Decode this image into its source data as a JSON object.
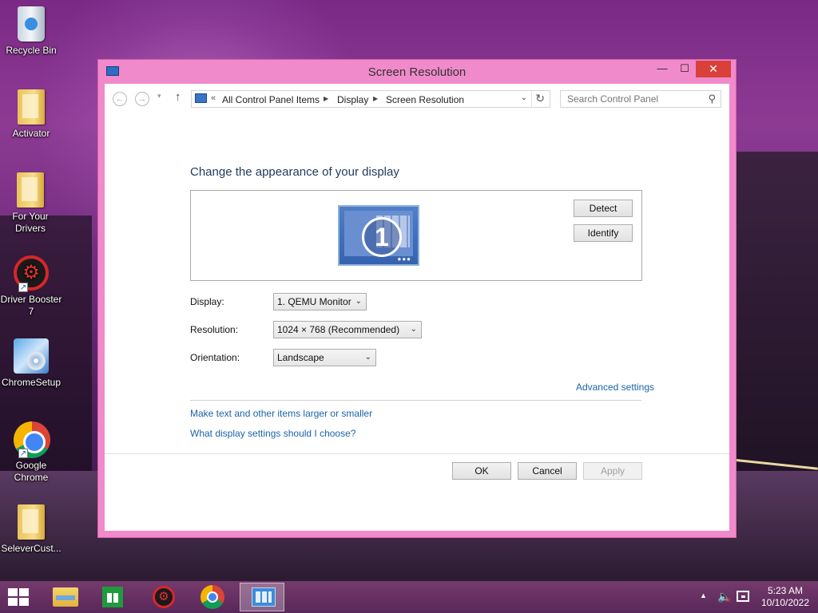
{
  "desktop": {
    "icons": [
      {
        "label": "Recycle Bin",
        "icon": "recycle-bin-icon"
      },
      {
        "label": "Activator",
        "icon": "folder-icon"
      },
      {
        "label": "For Your Drivers",
        "icon": "folder-icon"
      },
      {
        "label": "Driver Booster 7",
        "icon": "driver-booster-icon"
      },
      {
        "label": "ChromeSetup",
        "icon": "setup-cd-icon"
      },
      {
        "label": "Google Chrome",
        "icon": "chrome-icon"
      },
      {
        "label": "SeleverCust...",
        "icon": "folder-icon"
      }
    ]
  },
  "window": {
    "title": "Screen Resolution",
    "minimize_glyph": "—",
    "maximize_glyph": "☐",
    "close_glyph": "✕",
    "address": {
      "prefix": "«",
      "crumbs": [
        "All Control Panel Items",
        "Display",
        "Screen Resolution"
      ]
    },
    "search": {
      "placeholder": "Search Control Panel"
    },
    "heading": "Change the appearance of your display",
    "monitor_number": "1",
    "detect_label": "Detect",
    "identify_label": "Identify",
    "display_label": "Display:",
    "display_value": "1. QEMU Monitor",
    "resolution_label": "Resolution:",
    "resolution_value": "1024 × 768 (Recommended)",
    "orientation_label": "Orientation:",
    "orientation_value": "Landscape",
    "advanced_link": "Advanced settings",
    "text_size_link": "Make text and other items larger or smaller",
    "which_settings_link": "What display settings should I choose?",
    "ok_label": "OK",
    "cancel_label": "Cancel",
    "apply_label": "Apply"
  },
  "taskbar": {
    "items": [
      "file-explorer-icon",
      "store-icon",
      "driver-booster-icon",
      "chrome-icon",
      "screen-resolution-icon"
    ],
    "clock_time": "5:23 AM",
    "clock_date": "10/10/2022"
  },
  "colors": {
    "window_frame": "#f08acb",
    "close_button": "#d9403a",
    "link": "#1a63a8",
    "heading": "#1e395b"
  }
}
